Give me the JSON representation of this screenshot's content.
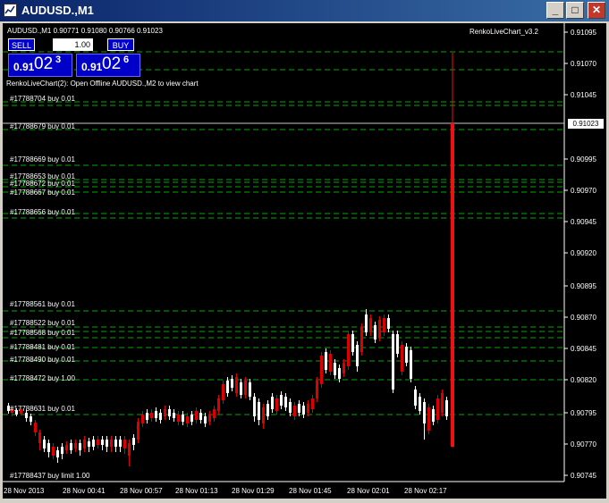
{
  "window": {
    "title": "AUDUSD.,M1",
    "minimize_label": "_",
    "maximize_label": "□",
    "close_label": "✕"
  },
  "chart": {
    "symbol_info": "AUDUSD.,M1  0.90771 0.91080 0.90766 0.91023",
    "indicator_name": "RenkoLiveChart_v3.2",
    "indicator_msg": "RenkoLiveChart(2): Open Offline AUDUSD.,M2 to view chart",
    "current_price": "0.91023",
    "colors": {
      "background": "#000000",
      "bull": "#ffffff",
      "bear": "#dd0000",
      "order_line": "#00aa00",
      "spike": "#ee1111"
    }
  },
  "trade_panel": {
    "sell_label": "SELL",
    "buy_label": "BUY",
    "lot_value": "1.00",
    "bid": {
      "big": "0.91",
      "pips": "02",
      "frac": "3"
    },
    "ask": {
      "big": "0.91",
      "pips": "02",
      "frac": "6"
    }
  },
  "price_axis": [
    "0.91095",
    "0.91070",
    "0.91045",
    "0.90995",
    "0.90970",
    "0.90945",
    "0.90920",
    "0.90895",
    "0.90870",
    "0.90845",
    "0.90820",
    "0.90795",
    "0.90770",
    "0.90745"
  ],
  "time_axis": [
    "28 Nov 2013",
    "28 Nov 00:41",
    "28 Nov 00:57",
    "28 Nov 01:13",
    "28 Nov 01:29",
    "28 Nov 01:45",
    "28 Nov 02:01",
    "28 Nov 02:17"
  ],
  "order_labels": [
    "#17788704 buy 0.01",
    "#17788679 buy 0.01",
    "#17788669 buy 0.01",
    "#17788653 buy 0.01",
    "#17788672 buy 0.01",
    "#17788667 buy 0.01",
    "#17788656 buy 0.01",
    "#17788561 buy 0.01",
    "#17788522 buy 0.01",
    "#17788568 buy 0.01",
    "#17788481 buy 0.01",
    "#17788490 buy 0.01",
    "#17788472 buy 1.00",
    "#17788631 buy 0.01",
    "#17788437 buy limit 1.00"
  ]
}
